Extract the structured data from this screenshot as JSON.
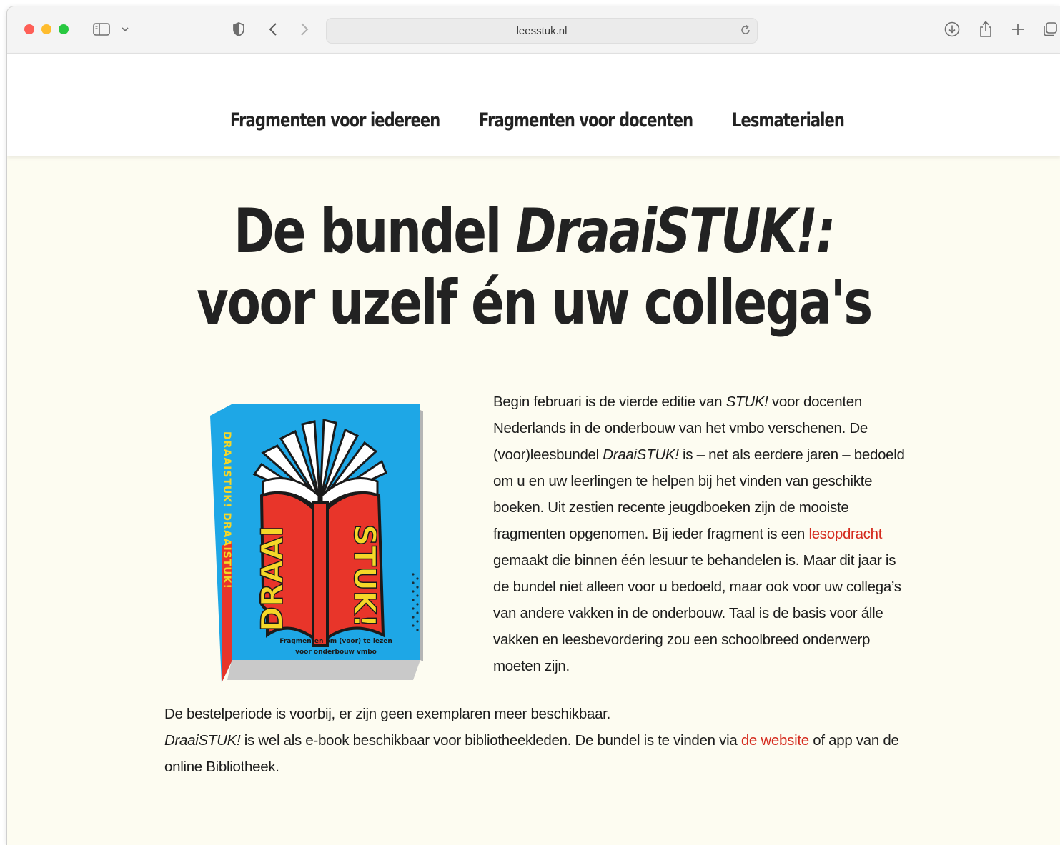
{
  "browser": {
    "url": "leesstuk.nl"
  },
  "nav": {
    "items": [
      {
        "label": "Fragmenten voor iedereen"
      },
      {
        "label": "Fragmenten voor docenten"
      },
      {
        "label": "Lesmaterialen"
      }
    ]
  },
  "headline": {
    "line1_prefix": "De bundel ",
    "line1_title": "DraaiSTUK!:",
    "line2": "voor uzelf én uw collega's"
  },
  "book": {
    "spine_text": "DRAAISTUK! DRAAISTUK!",
    "cover_left": "DRAAI",
    "cover_right": "STUK!",
    "subtitle_line1": "Fragmenten om (voor) te lezen",
    "subtitle_line2": "voor onderbouw vmbo"
  },
  "intro": {
    "t1": "Begin februari is de vierde editie van ",
    "t1_it": "STUK!",
    "t2": " voor docenten Nederlands in de onderbouw van het vmbo verschenen. De (voor)leesbundel ",
    "t2_it": "DraaiSTUK!",
    "t3": " is – net als eerdere jaren – bedoeld om u en uw leerlingen te helpen bij het vinden van geschikte boeken. Uit zestien recente jeugdboeken zijn de mooiste fragmenten opgenomen. Bij ieder fragment is een ",
    "link": "lesopdracht",
    "t4": " gemaakt die binnen één lesuur te behandelen is. Maar dit jaar is de bundel niet alleen voor u bedoeld, maar ook voor uw collega’s van andere vakken in de onderbouw. Taal is de basis voor álle vakken en leesbevordering zou een schoolbreed onderwerp moeten zijn."
  },
  "order": {
    "line1": "De bestelperiode is voorbij, er zijn geen exemplaren meer beschikbaar.",
    "l2_it": "DraaiSTUK!",
    "l2_text": " is wel als e-book beschikbaar voor bibliotheekleden. De bundel is te vinden via ",
    "link": "de website",
    "l2_end": " of app van de online Bibliotheek."
  },
  "colors": {
    "background": "#fdfcf1",
    "link": "#d42a1d",
    "book_blue": "#1ea7e6",
    "book_red": "#e8352a",
    "book_yellow": "#f5d728"
  }
}
